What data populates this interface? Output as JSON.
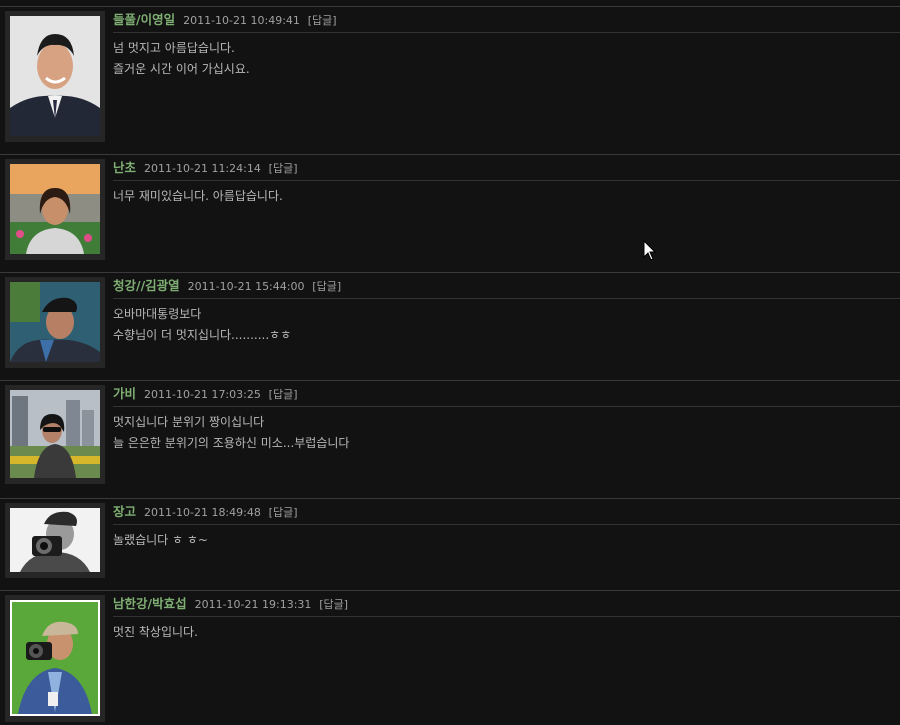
{
  "comments": [
    {
      "nickname": "들풀/이영일",
      "datetime": "2011-10-21 10:49:41",
      "reply_label": "[답글]",
      "lines": [
        "넘 멋지고 아름답습니다.",
        "즐거운 시간 이어 가십시요."
      ],
      "avatar": "avatar-man-in-suit"
    },
    {
      "nickname": "난초",
      "datetime": "2011-10-21 11:24:14",
      "reply_label": "[답글]",
      "lines": [
        "너무 재미있습니다. 아름답습니다."
      ],
      "avatar": "avatar-woman-flowers"
    },
    {
      "nickname": "청강//김광열",
      "datetime": "2011-10-21 15:44:00",
      "reply_label": "[답글]",
      "lines": [
        "오바마대통령보다",
        "수향님이 더 멋지십니다..........ㅎㅎ"
      ],
      "avatar": "avatar-man-cap"
    },
    {
      "nickname": "가비",
      "datetime": "2011-10-21 17:03:25",
      "reply_label": "[답글]",
      "lines": [
        "멋지십니다 분위기 짱이십니다",
        "늘 은은한 분위기의 조용하신 미소...부럽습니다"
      ],
      "avatar": "avatar-city-person"
    },
    {
      "nickname": "장고",
      "datetime": "2011-10-21 18:49:48",
      "reply_label": "[답글]",
      "lines": [
        "놀랬습니다 ㅎ ㅎ~"
      ],
      "avatar": "avatar-photographer-bw"
    },
    {
      "nickname": "남한강/박효섭",
      "datetime": "2011-10-21 19:13:31",
      "reply_label": "[답글]",
      "lines": [
        "멋진 착상입니다."
      ],
      "avatar": "avatar-photographer-color"
    }
  ],
  "colors": {
    "background": "#121212",
    "nickname": "#7fae73",
    "text": "#b8b8b8",
    "divider": "#3a3a3a"
  },
  "cursor_icon": "mouse-pointer-icon"
}
